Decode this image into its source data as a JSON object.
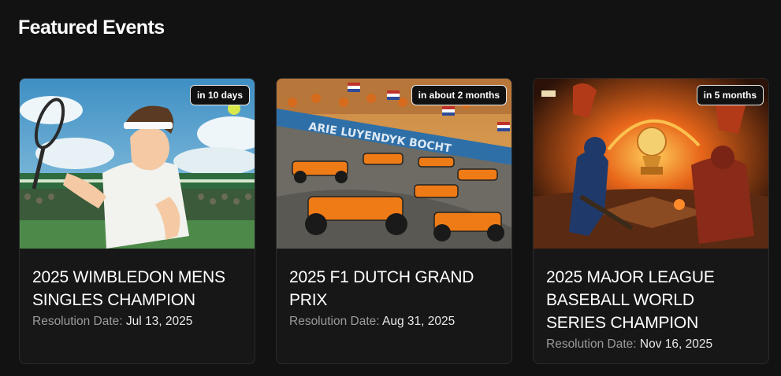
{
  "section": {
    "title": "Featured Events"
  },
  "events": [
    {
      "title": "2025 WIMBLEDON MENS SINGLES CHAMPION",
      "badge": "in 10 days",
      "resolution_label": "Resolution Date:",
      "resolution_date": "Jul 13, 2025",
      "image_icon": "tennis-player-illustration"
    },
    {
      "title": "2025 F1 DUTCH GRAND PRIX",
      "badge": "in about 2 months",
      "resolution_label": "Resolution Date:",
      "resolution_date": "Aug 31, 2025",
      "image_icon": "f1-race-illustration",
      "image_text": "ARIE LUYENDYK BOCHT"
    },
    {
      "title": "2025 MAJOR LEAGUE BASEBALL WORLD SERIES CHAMPION",
      "badge": "in 5 months",
      "resolution_label": "Resolution Date:",
      "resolution_date": "Nov 16, 2025",
      "image_icon": "baseball-trophy-illustration"
    }
  ],
  "colors": {
    "background": "#121212",
    "card": "#171717",
    "border": "#2b2b2b"
  }
}
